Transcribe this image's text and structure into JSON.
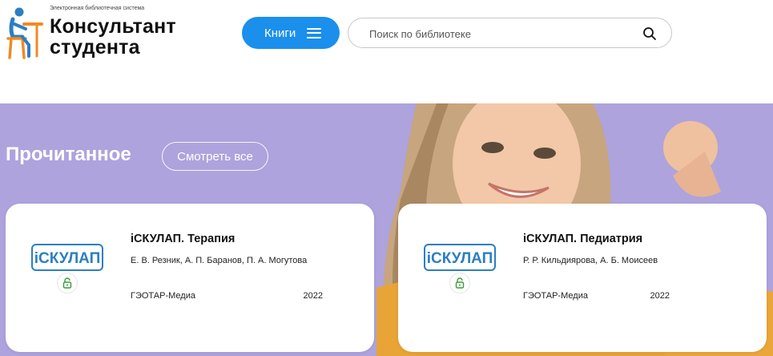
{
  "header": {
    "logo_subtitle": "Электронная библиотечная система",
    "logo_title": "Консультант\nстудента",
    "books_button_label": "Книги",
    "search_placeholder": "Поиск по библиотеке"
  },
  "hero": {
    "section_title": "Прочитанное",
    "view_all_label": "Смотреть все"
  },
  "books": [
    {
      "cover_label": "iСКУЛАП",
      "title": "iСКУЛАП. Терапия",
      "authors": "Е. В. Резник, А. П. Баранов, П. А. Могутова",
      "publisher": "ГЭОТАР-Медиа",
      "year": "2022"
    },
    {
      "cover_label": "iСКУЛАП",
      "title": "iСКУЛАП. Педиатрия",
      "authors": "Р. Р. Кильдиярова, А. Б. Моисеев",
      "publisher": "ГЭОТАР-Медиа",
      "year": "2022"
    }
  ],
  "colors": {
    "accent_blue": "#1a8fec",
    "hero_background": "#aea3dc",
    "lock_green": "#3a9a3a",
    "cover_blue": "#2b7fc3"
  },
  "icons": {
    "menu": "menu-icon",
    "search": "search-icon",
    "lock": "unlock-icon",
    "logo": "student-figure-icon"
  }
}
